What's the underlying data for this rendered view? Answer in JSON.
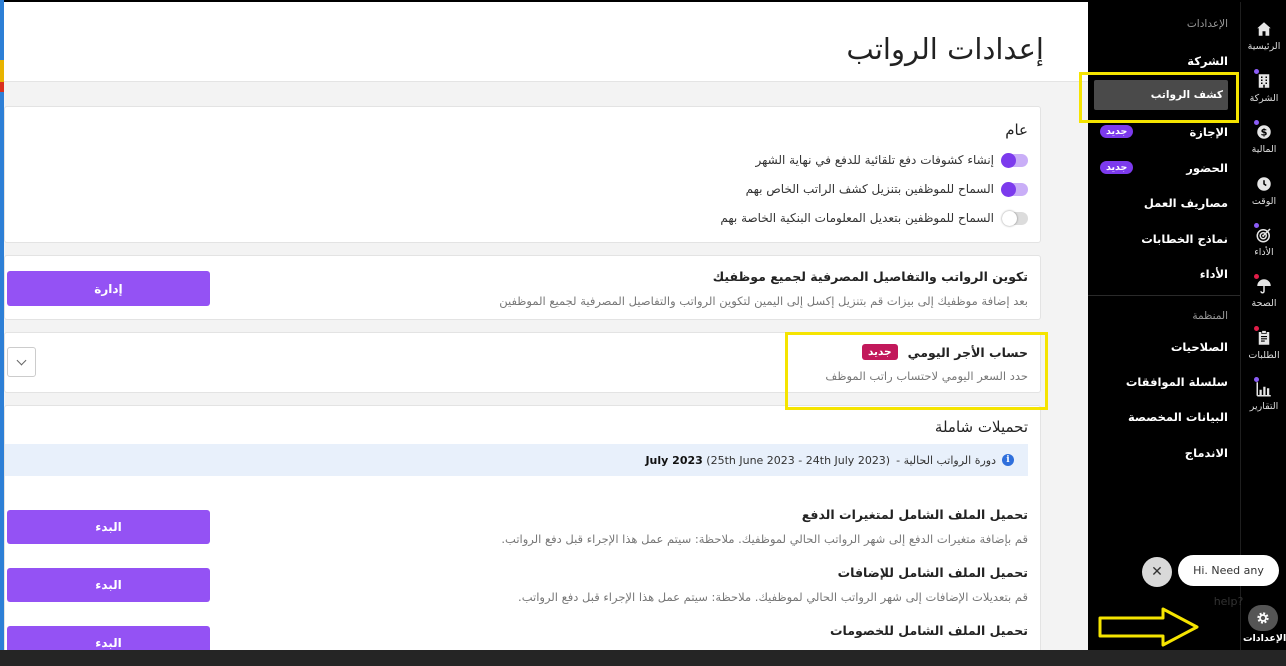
{
  "page": {
    "title": "إعدادات الرواتب"
  },
  "general": {
    "title": "عام",
    "toggles": [
      {
        "label": "إنشاء كشوفات دفع تلقائية للدفع في نهاية الشهر",
        "on": true
      },
      {
        "label": "السماح للموظفين بتنزيل كشف الراتب الخاص بهم",
        "on": true
      },
      {
        "label": "السماح للموظفين بتعديل المعلومات البنكية الخاصة بهم",
        "on": false
      }
    ]
  },
  "payroll_config": {
    "title": "تكوين الرواتب والتفاصيل المصرفية لجميع موظفيك",
    "description": "بعد إضافة موظفيك إلى بيزات قم بتنزيل إكسل إلى اليمين لتكوين الرواتب والتفاصيل المصرفية لجميع الموظفين",
    "button_label": "إدارة"
  },
  "daily_wage": {
    "title": "حساب الأجر اليومي",
    "badge": "جديد",
    "description": "حدد السعر اليومي لاحتساب راتب الموظف"
  },
  "bulk_uploads": {
    "title": "تحميلات شاملة",
    "cycle_prefix": "دورة الرواتب الحالية - ",
    "cycle_range": "(25th June 2023 - 24th July 2023)",
    "cycle_month": "July 2023",
    "items": [
      {
        "title": "تحميل الملف الشامل لمتغيرات الدفع",
        "description": "قم بإضافة متغيرات الدفع إلى شهر الرواتب الحالي لموظفيك. ملاحظة: سيتم عمل هذا الإجراء قبل دفع الرواتب.",
        "button_label": "البدء"
      },
      {
        "title": "تحميل الملف الشامل للإضافات",
        "description": "قم بتعديلات الإضافات إلى شهر الرواتب الحالي لموظفيك. ملاحظة: سيتم عمل هذا الإجراء قبل دفع الرواتب.",
        "button_label": "البدء"
      },
      {
        "title": "تحميل الملف الشامل للخصومات",
        "description": "",
        "button_label": "البدء"
      }
    ]
  },
  "sidebar": {
    "settings_heading": "الإعدادات",
    "items": [
      {
        "label": "الشركة"
      },
      {
        "label": "كشف الرواتب",
        "active": true
      },
      {
        "label": "الإجازة",
        "badge": "جديد"
      },
      {
        "label": "الحضور",
        "badge": "جديد"
      },
      {
        "label": "مصاريف العمل"
      },
      {
        "label": "نماذج الخطابات"
      },
      {
        "label": "الأداء"
      }
    ],
    "org_heading": "المنظمة",
    "org_items": [
      {
        "label": "الصلاحيات"
      },
      {
        "label": "سلسلة الموافقات"
      },
      {
        "label": "البيانات المخصصة"
      },
      {
        "label": "الاندماج"
      }
    ]
  },
  "rail": {
    "items": [
      {
        "label": "الرئيسية",
        "icon": "home-icon"
      },
      {
        "label": "الشركة",
        "icon": "building-icon"
      },
      {
        "label": "المالية",
        "icon": "dollar-icon"
      },
      {
        "label": "الوقت",
        "icon": "clock-icon"
      },
      {
        "label": "الأداء",
        "icon": "target-icon"
      },
      {
        "label": "الصحة",
        "icon": "umbrella-icon"
      },
      {
        "label": "الطلبات",
        "icon": "clipboard-icon"
      },
      {
        "label": "التقارير",
        "icon": "chart-icon"
      }
    ],
    "settings_label": "الإعدادات"
  },
  "chat": {
    "message": "Hi. Need any help?",
    "close_symbol": "✕"
  },
  "colors": {
    "accent": "#9452f4",
    "new_badge": "#c2185b",
    "sidebar_badge": "#7c3aed",
    "annotation": "#f5e400"
  }
}
